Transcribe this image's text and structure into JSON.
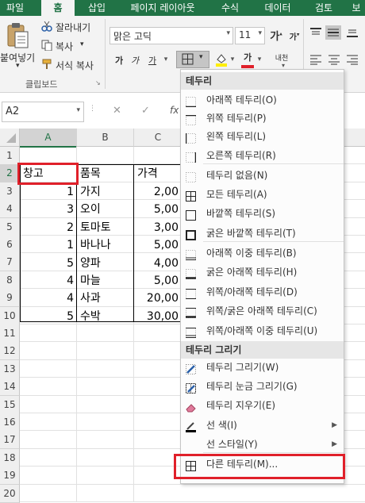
{
  "ribbon_tabs": [
    "파일",
    "홈",
    "삽입",
    "페이지 레이아웃",
    "수식",
    "데이터",
    "검토",
    "보"
  ],
  "clipboard": {
    "paste_label": "붙여넣기",
    "cut_label": "잘라내기",
    "copy_label": "복사",
    "format_painter_label": "서식 복사",
    "group_label": "클립보드"
  },
  "font": {
    "name": "맑은 고딕",
    "size": "11",
    "grow_glyph": "가",
    "shrink_glyph": "가",
    "bold_glyph": "가",
    "italic_glyph": "가",
    "underline_glyph": "가",
    "font_color_glyph": "가",
    "phonetic_glyph": "내천"
  },
  "name_box": "A2",
  "formula_icons": {
    "cancel": "✕",
    "enter": "✓",
    "fx": "fx"
  },
  "columns": [
    "A",
    "B",
    "C"
  ],
  "selected_column": "A",
  "rows": [
    "1",
    "2",
    "3",
    "4",
    "5",
    "6",
    "7",
    "8",
    "9",
    "10",
    "11",
    "12",
    "13",
    "14",
    "15",
    "16",
    "17",
    "18",
    "19",
    "20"
  ],
  "selected_row": "2",
  "table": {
    "headers": [
      "창고",
      "품목",
      "가격"
    ],
    "data": [
      [
        "1",
        "가지",
        "2,00"
      ],
      [
        "3",
        "오이",
        "5,00"
      ],
      [
        "2",
        "토마토",
        "3,00"
      ],
      [
        "1",
        "바나나",
        "5,00"
      ],
      [
        "5",
        "양파",
        "4,00"
      ],
      [
        "4",
        "마늘",
        "5,00"
      ],
      [
        "4",
        "사과",
        "20,00"
      ],
      [
        "5",
        "수박",
        "30,00"
      ]
    ]
  },
  "border_menu": {
    "section1_title": "테두리",
    "section1_items": [
      {
        "label": "아래쪽 테두리(O)",
        "icon": "bottom-border-icon"
      },
      {
        "label": "위쪽 테두리(P)",
        "icon": "top-border-icon"
      },
      {
        "label": "왼쪽 테두리(L)",
        "icon": "left-border-icon"
      },
      {
        "label": "오른쪽 테두리(R)",
        "icon": "right-border-icon"
      },
      {
        "label": "테두리 없음(N)",
        "icon": "no-border-icon"
      },
      {
        "label": "모든 테두리(A)",
        "icon": "all-borders-icon"
      },
      {
        "label": "바깥쪽 테두리(S)",
        "icon": "outside-borders-icon"
      },
      {
        "label": "굵은 바깥쪽 테두리(T)",
        "icon": "thick-outside-borders-icon"
      },
      {
        "label": "아래쪽 이중 테두리(B)",
        "icon": "bottom-double-border-icon"
      },
      {
        "label": "굵은 아래쪽 테두리(H)",
        "icon": "thick-bottom-border-icon"
      },
      {
        "label": "위쪽/아래쪽 테두리(D)",
        "icon": "top-bottom-border-icon"
      },
      {
        "label": "위쪽/굵은 아래쪽 테두리(C)",
        "icon": "top-thick-bottom-border-icon"
      },
      {
        "label": "위쪽/아래쪽 이중 테두리(U)",
        "icon": "top-double-bottom-border-icon"
      }
    ],
    "section2_title": "테두리 그리기",
    "section2_items": [
      {
        "label": "테두리 그리기(W)",
        "icon": "draw-border-icon"
      },
      {
        "label": "테두리 눈금 그리기(G)",
        "icon": "draw-border-grid-icon"
      },
      {
        "label": "테두리 지우기(E)",
        "icon": "eraser-icon"
      },
      {
        "label": "선 색(I)",
        "icon": "line-color-icon"
      },
      {
        "label": "선 스타일(Y)",
        "icon": "line-style-icon"
      },
      {
        "label": "다른 테두리(M)...",
        "icon": "more-borders-icon"
      }
    ]
  },
  "colors": {
    "excel_green": "#217346",
    "highlight_red": "#e0202a",
    "font_color_red": "#e0202a",
    "fill_yellow": "#ffee00"
  }
}
